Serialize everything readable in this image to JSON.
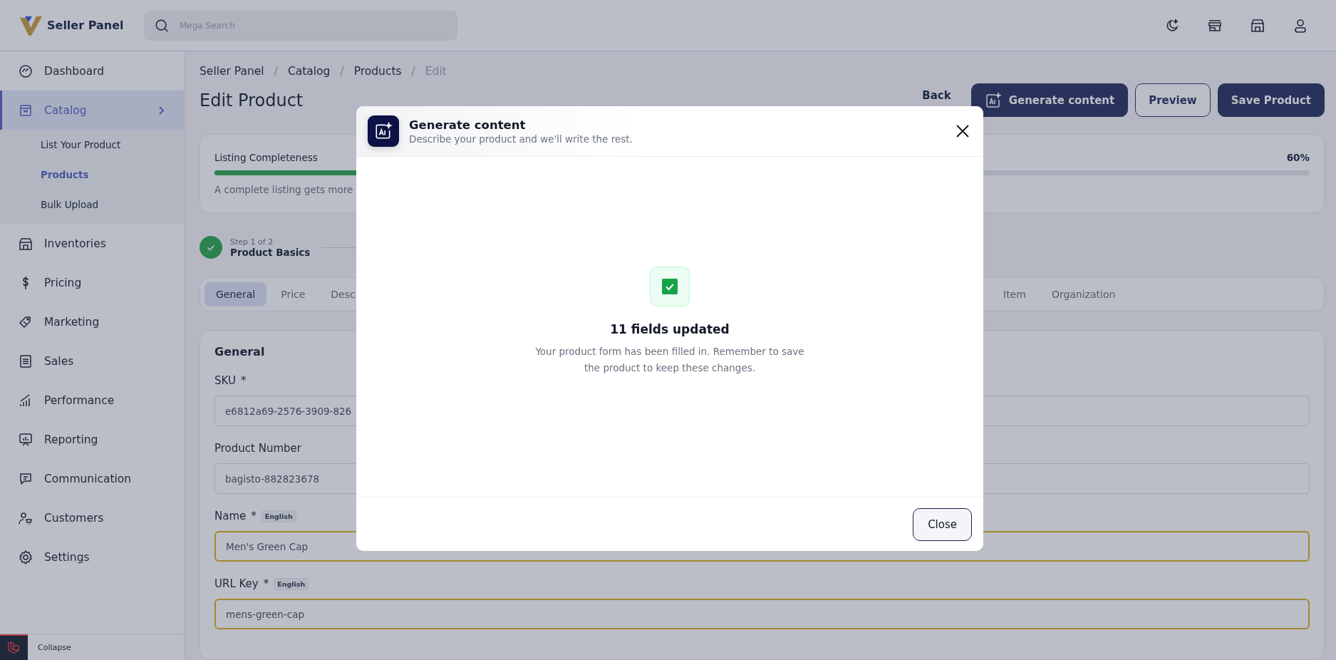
{
  "header": {
    "brand": "Seller Panel",
    "search": {
      "placeholder": "Mega Search"
    }
  },
  "sidebar": {
    "items": [
      {
        "label": "Dashboard",
        "selected": false
      },
      {
        "label": "Catalog",
        "selected": true,
        "expanded": true,
        "children": [
          {
            "label": "List Your Product",
            "selected": false
          },
          {
            "label": "Products",
            "selected": true
          },
          {
            "label": "Bulk Upload",
            "selected": false
          }
        ]
      },
      {
        "label": "Inventories",
        "selected": false
      },
      {
        "label": "Pricing",
        "selected": false
      },
      {
        "label": "Marketing",
        "selected": false
      },
      {
        "label": "Sales",
        "selected": false
      },
      {
        "label": "Performance",
        "selected": false
      },
      {
        "label": "Reporting",
        "selected": false
      },
      {
        "label": "Communication",
        "selected": false
      },
      {
        "label": "Customers",
        "selected": false
      },
      {
        "label": "Settings",
        "selected": false
      }
    ],
    "collapse": "Collapse"
  },
  "breadcrumb": {
    "separator": "/",
    "items": [
      "Seller Panel",
      "Catalog",
      "Products",
      "Edit"
    ]
  },
  "page": {
    "title": "Edit Product",
    "back": "Back",
    "buttons": [
      {
        "label": "Generate content",
        "kind": "ai"
      },
      {
        "label": "Preview",
        "kind": "outline"
      },
      {
        "label": "Save Product",
        "kind": "primary"
      }
    ]
  },
  "completeness": {
    "label": "Listing Completeness",
    "reading": "60%",
    "level": 0.6,
    "hint": "A complete listing gets more"
  },
  "stepper": [
    {
      "step": "Step 1 of 2",
      "title": "Product Basics",
      "done": true
    }
  ],
  "tabs": [
    {
      "label": "General",
      "selected": true
    },
    {
      "label": "Price",
      "selected": false
    },
    {
      "label": "Desc",
      "selected": false
    },
    {
      "label": "Item",
      "selected": false
    },
    {
      "label": "Organization",
      "selected": false
    }
  ],
  "section": {
    "title": "General",
    "fields": [
      {
        "label": "SKU",
        "mark": "*",
        "value": "e6812a69-2576-3909-826",
        "highlighted": false
      },
      {
        "label": "Product Number",
        "value": "bagisto-882823678",
        "highlighted": false
      },
      {
        "label": "Name",
        "mark": "*",
        "locale": "English",
        "value": "Men's Green Cap",
        "highlighted": true
      },
      {
        "label": "URL Key",
        "mark": "*",
        "locale": "English",
        "value": "mens-green-cap",
        "highlighted": true
      }
    ]
  },
  "modal": {
    "title": "Generate content",
    "subtitle": "Describe your product and we'll write the rest.",
    "result_title": "11 fields updated",
    "result_text": "Your product form has been filled in. Remember to save the product to keep these changes.",
    "buttons": [
      "Close"
    ]
  }
}
